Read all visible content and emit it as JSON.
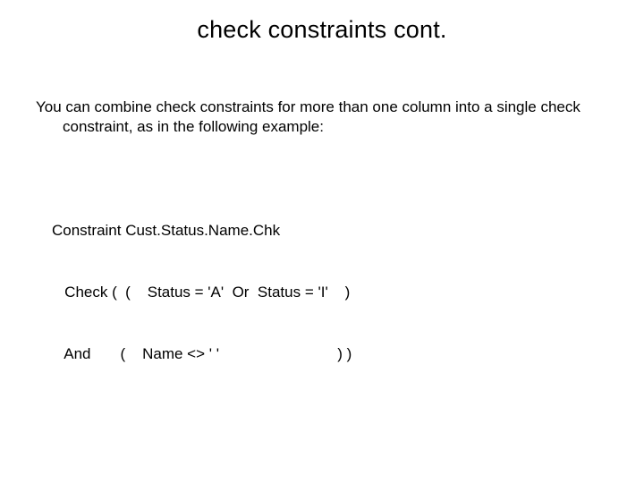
{
  "slide": {
    "title": "check constraints cont.",
    "body": "You can combine check constraints for more than one column into a single check constraint, as in the following example:",
    "code_line1": "Constraint Cust.Status.Name.Chk",
    "code_line2": "   Check (  (    Status = 'A'  Or  Status = 'I'    )",
    "code_line3": "   And       (    Name <> ' '                            ) )"
  }
}
